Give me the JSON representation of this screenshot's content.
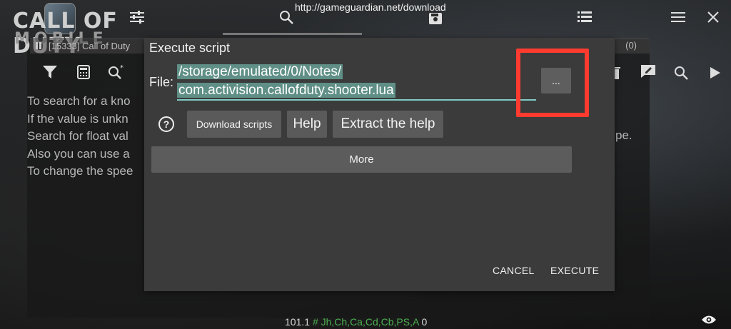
{
  "browser": {
    "url": "http://gameguardian.net/download"
  },
  "game_logo": {
    "title": "CALL OF DUTY",
    "subtitle": "MOBILE"
  },
  "process": {
    "label": "[15333] Call of Duty",
    "count": "(0)"
  },
  "help_text": {
    "lines": [
      "To search for a kno",
      "If the value is unkn",
      "Search for float val",
      "Also you can use a",
      "To change the spee"
    ],
    "tail": "pe."
  },
  "dialog": {
    "title": "Execute script",
    "file_label": "File:",
    "file_line1": "/storage/emulated/0/Notes/",
    "file_line2": "com.activision.callofduty.shooter.lua",
    "browse_label": "...",
    "help_icon": "?",
    "buttons": {
      "download_scripts": "Download scripts",
      "help": "Help",
      "extract_help": "Extract the help",
      "more": "More"
    },
    "cancel": "CANCEL",
    "execute": "EXECUTE"
  },
  "status_bar": {
    "value": "101.1",
    "flags": "# Jh,Ch,Ca,Cd,Cb,PS,A",
    "count": "0"
  },
  "colors": {
    "dialog_bg": "#3b3b3b",
    "selection": "#5f8f86",
    "underline": "#80cbc4",
    "highlight_box": "#ff3b30",
    "sidebar_bg": "#2c3b45"
  }
}
